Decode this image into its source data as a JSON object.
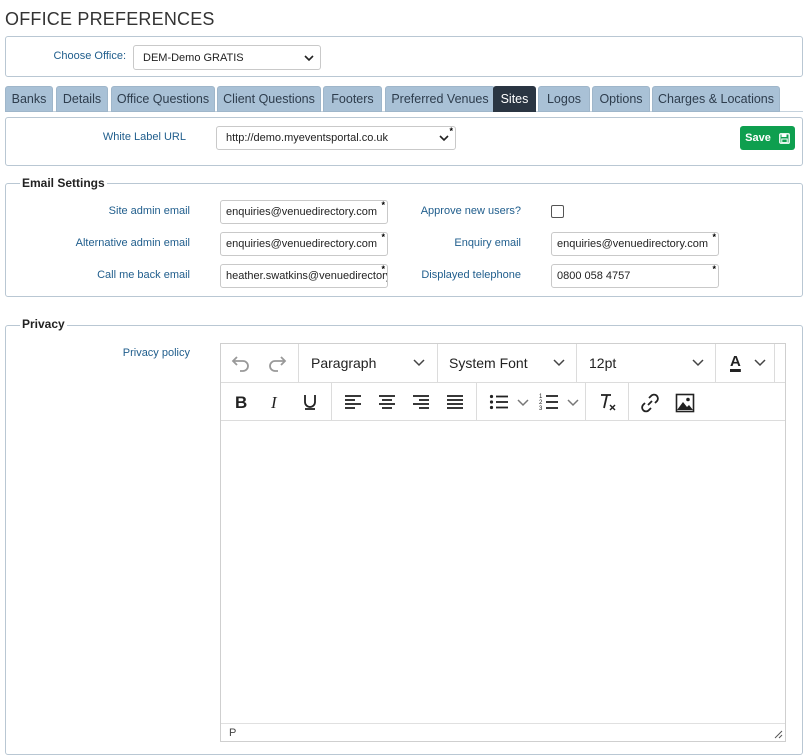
{
  "page": {
    "title": "OFFICE PREFERENCES"
  },
  "office": {
    "label": "Choose Office:",
    "selected": "DEM-Demo GRATIS"
  },
  "tabs": [
    {
      "label": "Banks"
    },
    {
      "label": "Details"
    },
    {
      "label": "Office Questions"
    },
    {
      "label": "Client Questions"
    },
    {
      "label": "Footers"
    },
    {
      "label": "Preferred Venues"
    },
    {
      "label": "Sites",
      "active": true
    },
    {
      "label": "Logos"
    },
    {
      "label": "Options"
    },
    {
      "label": "Charges & Locations"
    }
  ],
  "sites": {
    "white_label_label": "White Label URL",
    "white_label_value": "http://demo.myeventsportal.co.uk",
    "save_label": "Save"
  },
  "email_settings": {
    "legend": "Email Settings",
    "site_admin_label": "Site admin email",
    "site_admin_value": "enquiries@venuedirectory.com",
    "approve_label": "Approve new users?",
    "approve_checked": false,
    "alt_admin_label": "Alternative admin email",
    "alt_admin_value": "enquiries@venuedirectory.com",
    "enquiry_label": "Enquiry email",
    "enquiry_value": "enquiries@venuedirectory.com",
    "callback_label": "Call me back email",
    "callback_value": "heather.swatkins@venuedirectory.com",
    "telephone_label": "Displayed telephone",
    "telephone_value": "0800 058 4757"
  },
  "privacy": {
    "legend": "Privacy",
    "policy_label": "Privacy policy",
    "editor": {
      "block_format": "Paragraph",
      "font_family": "System Font",
      "font_size": "12pt",
      "text_color_label": "A",
      "status_path": "P"
    }
  },
  "colors": {
    "accent": "#1f5d8c",
    "tab_bg": "#a9c1d6",
    "tab_active_bg": "#2a3542",
    "save_bg": "#0e9f4f"
  },
  "icons": [
    "chevron-down-icon",
    "save-icon",
    "undo-icon",
    "redo-icon",
    "bold-icon",
    "italic-icon",
    "underline-icon",
    "align-left-icon",
    "align-center-icon",
    "align-right-icon",
    "align-justify-icon",
    "bullet-list-icon",
    "numbered-list-icon",
    "clear-formatting-icon",
    "link-icon",
    "image-icon",
    "resize-handle-icon"
  ]
}
